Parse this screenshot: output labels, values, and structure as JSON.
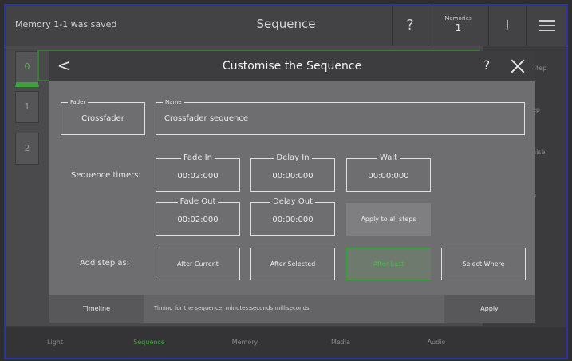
{
  "topbar": {
    "status": "Memory 1-1 was saved",
    "title": "Sequence",
    "help": "?",
    "memories_label": "Memories",
    "memories_value": "1",
    "user": "J"
  },
  "sequences": [
    "0",
    "1",
    "2"
  ],
  "side_fragments": [
    "Step",
    "ep",
    "nise",
    "e"
  ],
  "bottom_nav": [
    "Light",
    "Sequence",
    "Memory",
    "Media",
    "Audio"
  ],
  "dialog": {
    "back": "<",
    "title": "Customise the Sequence",
    "help": "?",
    "fader": {
      "legend": "Fader",
      "value": "Crossfader"
    },
    "name": {
      "legend": "Name",
      "value": "Crossfader sequence"
    },
    "timers_label": "Sequence timers:",
    "fade_in": {
      "legend": "Fade In",
      "value": "00:02:000"
    },
    "delay_in": {
      "legend": "Delay In",
      "value": "00:00:000"
    },
    "wait": {
      "legend": "Wait",
      "value": "00:00:000"
    },
    "fade_out": {
      "legend": "Fade Out",
      "value": "00:02:000"
    },
    "delay_out": {
      "legend": "Delay Out",
      "value": "00:00:000"
    },
    "apply_all": "Apply to all steps",
    "add_step_label": "Add step as:",
    "after_current": "After Current",
    "after_selected": "After Selected",
    "after_last": "After Last",
    "select_where": "Select Where",
    "footer": {
      "timeline": "Timeline",
      "info": "Timing for the sequence: minutes:seconds:milliseconds",
      "apply": "Apply"
    }
  },
  "colors": {
    "accent_green": "#3da03d",
    "frame_border": "#2a33a8"
  }
}
